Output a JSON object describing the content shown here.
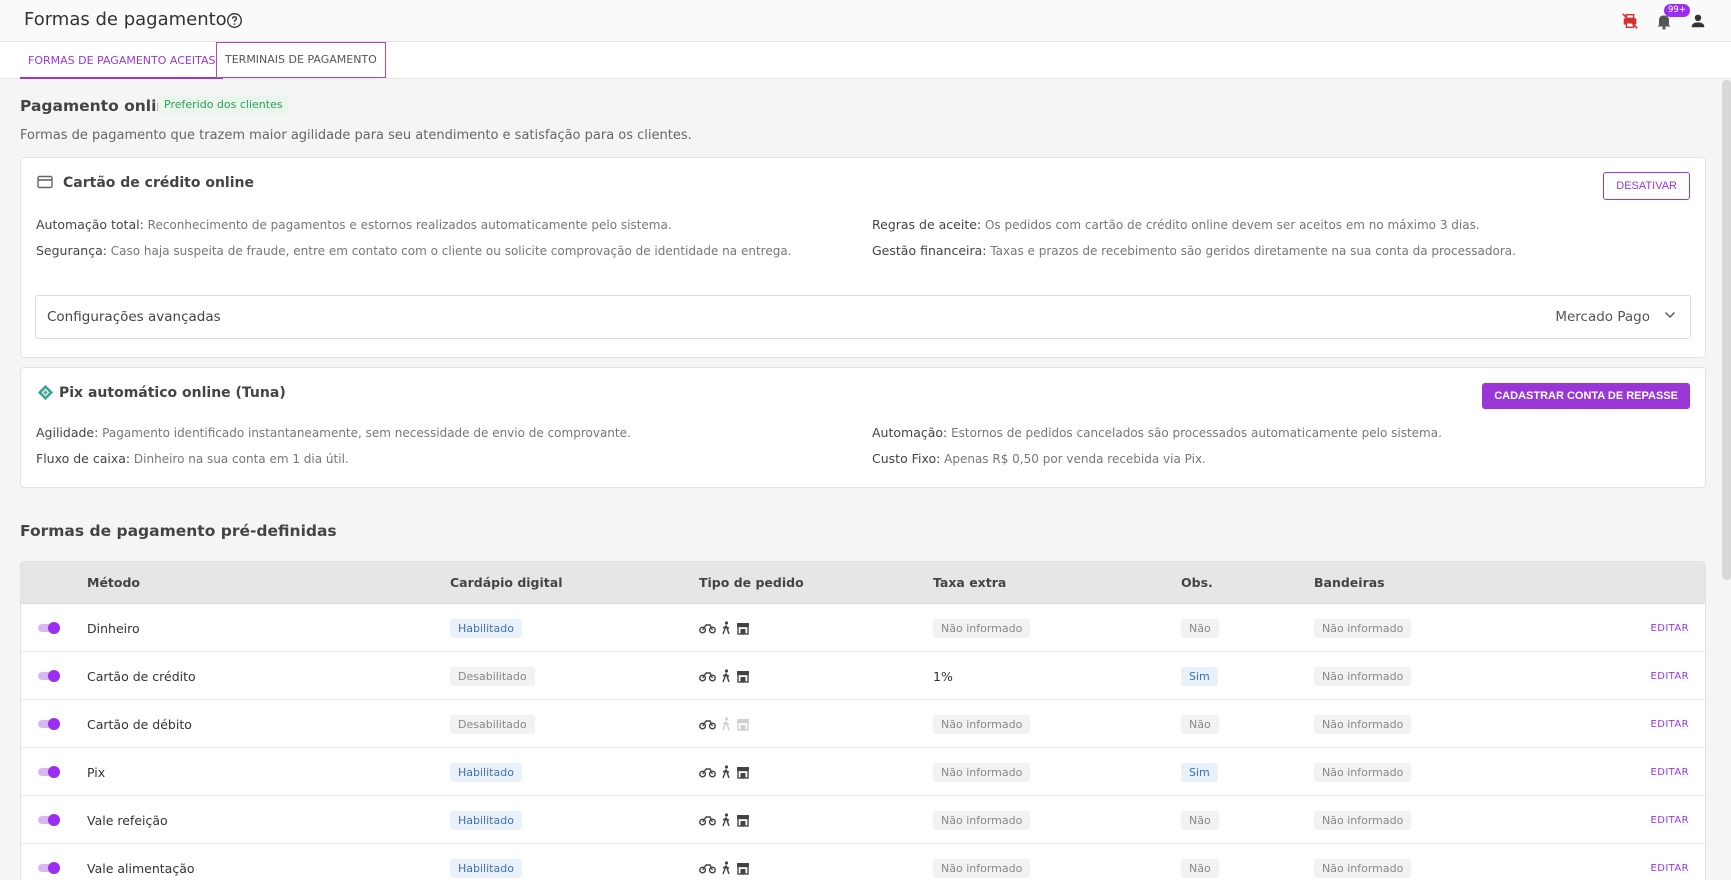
{
  "header": {
    "title": "Formas de pagamento",
    "notifications_badge": "99+"
  },
  "tabs": [
    {
      "label": "FORMAS DE PAGAMENTO ACEITAS",
      "active": true
    },
    {
      "label": "TERMINAIS DE PAGAMENTO",
      "active": false
    }
  ],
  "online": {
    "title": "Pagamento online",
    "badge": "Preferido dos clientes",
    "subtitle": "Formas de pagamento que trazem maior agilidade para seu atendimento e satisfação para os clientes."
  },
  "credit_card": {
    "title": "Cartão de crédito online",
    "button": "DESATIVAR",
    "info": [
      {
        "label": "Automação total:",
        "text": "Reconhecimento de pagamentos e estornos realizados automaticamente pelo sistema."
      },
      {
        "label": "Regras de aceite:",
        "text": "Os pedidos com cartão de crédito online devem ser aceitos em no máximo 3 dias."
      },
      {
        "label": "Segurança:",
        "text": "Caso haja suspeita de fraude, entre em contato com o cliente ou solicite comprovação de identidade na entrega."
      },
      {
        "label": "Gestão financeira:",
        "text": "Taxas e prazos de recebimento são geridos diretamente na sua conta da processadora."
      }
    ],
    "advanced_label": "Configurações avançadas",
    "advanced_value": "Mercado Pago"
  },
  "pix": {
    "title": "Pix automático online (Tuna)",
    "button": "CADASTRAR CONTA DE REPASSE",
    "info": [
      {
        "label": "Agilidade:",
        "text": "Pagamento identificado instantaneamente, sem necessidade de envio de comprovante."
      },
      {
        "label": "Automação:",
        "text": "Estornos de pedidos cancelados são processados automaticamente pelo sistema."
      },
      {
        "label": "Fluxo de caixa:",
        "text": "Dinheiro na sua conta em 1 dia útil."
      },
      {
        "label": "Custo Fixo:",
        "text": "Apenas R$ 0,50 por venda recebida via Pix."
      }
    ]
  },
  "predefined": {
    "title": "Formas de pagamento pré-definidas",
    "columns": [
      "Método",
      "Cardápio digital",
      "Tipo de pedido",
      "Taxa extra",
      "Obs.",
      "Bandeiras"
    ],
    "edit_label": "EDITAR",
    "rows": [
      {
        "method": "Dinheiro",
        "menu": "Habilitado",
        "fee": "Não informado",
        "obs": "Não",
        "brands": "Não informado"
      },
      {
        "method": "Cartão de crédito",
        "menu": "Desabilitado",
        "fee": "1%",
        "obs": "Sim",
        "brands": "Não informado"
      },
      {
        "method": "Cartão de débito",
        "menu": "Desabilitado",
        "fee": "Não informado",
        "obs": "Não",
        "brands": "Não informado"
      },
      {
        "method": "Pix",
        "menu": "Habilitado",
        "fee": "Não informado",
        "obs": "Sim",
        "brands": "Não informado"
      },
      {
        "method": "Vale refeição",
        "menu": "Habilitado",
        "fee": "Não informado",
        "obs": "Não",
        "brands": "Não informado"
      },
      {
        "method": "Vale alimentação",
        "menu": "Habilitado",
        "fee": "Não informado",
        "obs": "Não",
        "brands": "Não informado"
      }
    ]
  },
  "colors": {
    "accent": "#9a36d6",
    "green": "#2f9e56",
    "badge": "#9b2df5"
  }
}
